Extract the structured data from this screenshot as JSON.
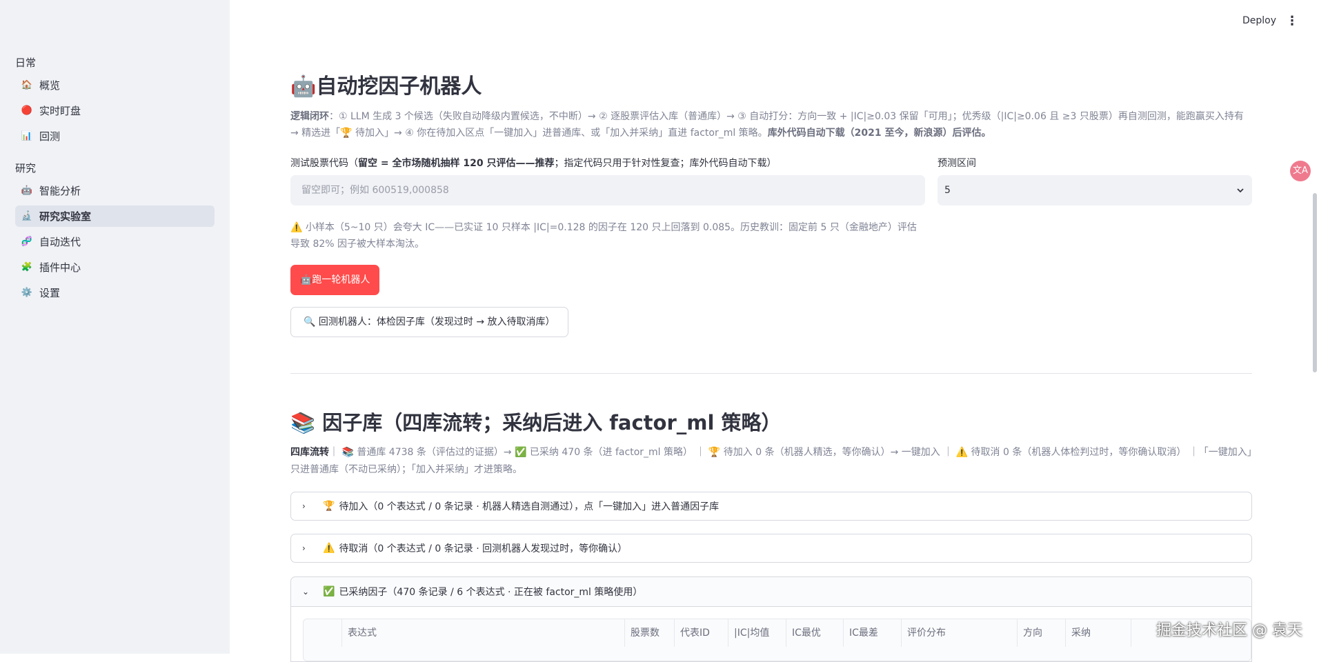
{
  "header": {
    "deploy_label": "Deploy",
    "menu_icon": "⋮"
  },
  "sidebar": {
    "sections": [
      {
        "title": "日常",
        "items": [
          {
            "icon": "🏠",
            "label": "概览"
          },
          {
            "icon": "🔴",
            "label": "实时盯盘"
          },
          {
            "icon": "📊",
            "label": "回测"
          }
        ]
      },
      {
        "title": "研究",
        "items": [
          {
            "icon": "🤖",
            "label": "智能分析"
          },
          {
            "icon": "🔬",
            "label": "研究实验室",
            "active": true
          },
          {
            "icon": "🧬",
            "label": "自动迭代"
          },
          {
            "icon": "🧩",
            "label": "插件中心"
          },
          {
            "icon": "⚙️",
            "label": "设置"
          }
        ]
      }
    ]
  },
  "main": {
    "title": "🤖自动挖因子机器人",
    "logic": {
      "lead": "逻辑闭环",
      "body": "：① LLM 生成 3 个候选（失败自动降级内置候选，不中断）→ ② 逐股票评估入库（普通库）→ ③ 自动打分：方向一致 + |IC|≥0.03 保留「可用」；优秀级（|IC|≥0.06 且 ≥3 只股票）再自测回测，能跑赢买入持有 → 精选进「🏆 待加入」→ ④ 你在待加入区点「一键加入」进普通库、或「加入并采纳」直进 factor_ml 策略。",
      "tail": "库外代码自动下载（2021 至今，新浪源）后评估。"
    },
    "stock": {
      "label_prefix": "测试股票代码（",
      "label_bold": "留空 = 全市场随机抽样 120 只评估——推荐",
      "label_suffix": "；指定代码只用于针对性复查；库外代码自动下载）",
      "placeholder": "留空即可；例如 600519,000858",
      "value": ""
    },
    "period": {
      "label": "预测区间",
      "value": "5"
    },
    "warning": "⚠️ 小样本（5~10 只）会夸大 IC——已实证 10 只样本 |IC|=0.128 的因子在 120 只上回落到 0.085。历史教训：固定前 5 只（金融地产）评估导致 82% 因子被大样本淘汰。",
    "run_button": "🤖跑一轮机器人",
    "backtest_button": "🔍 回测机器人：体检因子库（发现过时 → 放入待取消库）",
    "library": {
      "title": "📚 因子库（四库流转；采纳后进入 factor_ml 策略）",
      "flow_lead": "四库流转",
      "flow_body": "｜ 📚 普通库 4738 条（评估过的证据）→ ✅ 已采纳 470 条（进 factor_ml 策略） ｜ 🏆 待加入 0 条（机器人精选，等你确认）→ 一键加入 ｜ ⚠️ 待取消 0 条（机器人体检判过时，等你确认取消） ｜「一键加入」只进普通库（不动已采纳）；「加入并采纳」才进策略。",
      "expanders": [
        {
          "chevron": "›",
          "icon": "🏆",
          "label": "待加入（0 个表达式 / 0 条记录 · 机器人精选自测通过），点「一键加入」进入普通因子库"
        },
        {
          "chevron": "›",
          "icon": "⚠️",
          "label": "待取消（0 个表达式 / 0 条记录 · 回测机器人发现过时，等你确认）"
        },
        {
          "chevron": "⌄",
          "icon": "✅",
          "label": "已采纳因子（470 条记录 / 6 个表达式 · 正在被 factor_ml 策略使用）"
        }
      ],
      "table_columns": [
        "",
        "表达式",
        "股票数",
        "代表ID",
        "|IC|均值",
        "IC最优",
        "IC最差",
        "评价分布",
        "方向",
        "采纳",
        ""
      ]
    }
  },
  "translate_fab": "文A",
  "watermark": "掘金技术社区 @ 袁天"
}
